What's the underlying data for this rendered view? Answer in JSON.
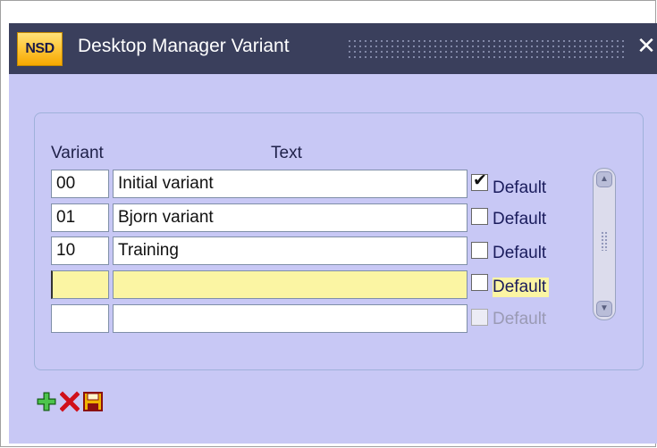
{
  "window": {
    "title": "Desktop Manager Variant",
    "logo": "NSD",
    "close": "✕"
  },
  "table": {
    "headers": {
      "variant": "Variant",
      "text": "Text"
    },
    "rows": [
      {
        "variant": "00",
        "text": "Initial variant",
        "default": true,
        "label": "Default"
      },
      {
        "variant": "01",
        "text": "Bjorn variant",
        "default": false,
        "label": "Default"
      },
      {
        "variant": "10",
        "text": "Training",
        "default": false,
        "label": "Default"
      },
      {
        "variant": "",
        "text": "",
        "default": false,
        "label": "Default"
      },
      {
        "variant": "",
        "text": "",
        "default": false,
        "label": "Default"
      }
    ]
  },
  "toolbar": {
    "add_icon": "plus-icon",
    "delete_icon": "delete-x-icon",
    "save_icon": "save-icon"
  },
  "colors": {
    "titlebar": "#3a3f5c",
    "body": "#c8c8f5",
    "highlight": "#fbf5a3"
  }
}
